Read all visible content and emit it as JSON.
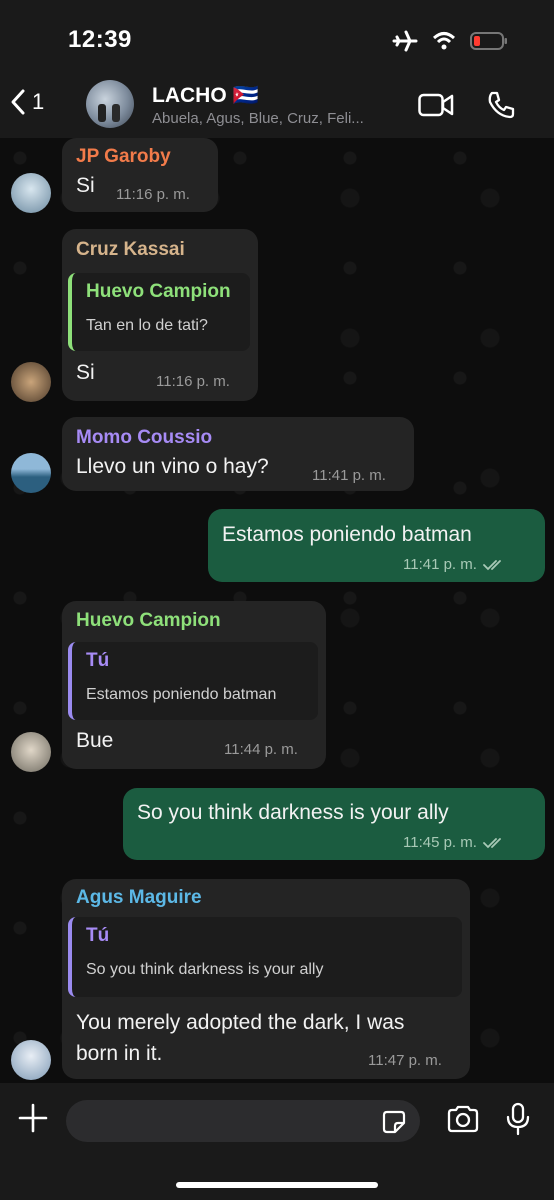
{
  "status": {
    "time": "12:39"
  },
  "header": {
    "back_count": "1",
    "group_name": "LACHO 🇨🇺",
    "members": "Abuela, Agus, Blue, Cruz, Feli..."
  },
  "messages": [
    {
      "sender": "JP Garoby",
      "sender_color": "#f27b4a",
      "text": "Si",
      "time": "11:16 p. m."
    },
    {
      "sender": "Cruz Kassai",
      "sender_color": "#d6b48c",
      "reply": {
        "name": "Huevo Campion",
        "name_color": "#8ee07a",
        "text": "Tan en lo de tati?"
      },
      "text": "Si",
      "time": "11:16 p. m."
    },
    {
      "sender": "Momo Coussio",
      "sender_color": "#a78bf5",
      "text": "Llevo un vino o hay?",
      "time": "11:41 p. m."
    },
    {
      "outgoing": true,
      "text": "Estamos poniendo batman",
      "time": "11:41 p. m."
    },
    {
      "sender": "Huevo Campion",
      "sender_color": "#8ee07a",
      "reply": {
        "name": "Tú",
        "name_color": "#a78bf5",
        "text": "Estamos poniendo batman"
      },
      "text": "Bue",
      "time": "11:44 p. m."
    },
    {
      "outgoing": true,
      "text": "So you think darkness is your ally",
      "time": "11:45 p. m."
    },
    {
      "sender": "Agus Maguire",
      "sender_color": "#5cb8e6",
      "reply": {
        "name": "Tú",
        "name_color": "#a78bf5",
        "text": "So you think darkness is your ally"
      },
      "text_line1": "You merely adopted the dark, I was",
      "text_line2": "born in it.",
      "time": "11:47 p. m."
    }
  ]
}
